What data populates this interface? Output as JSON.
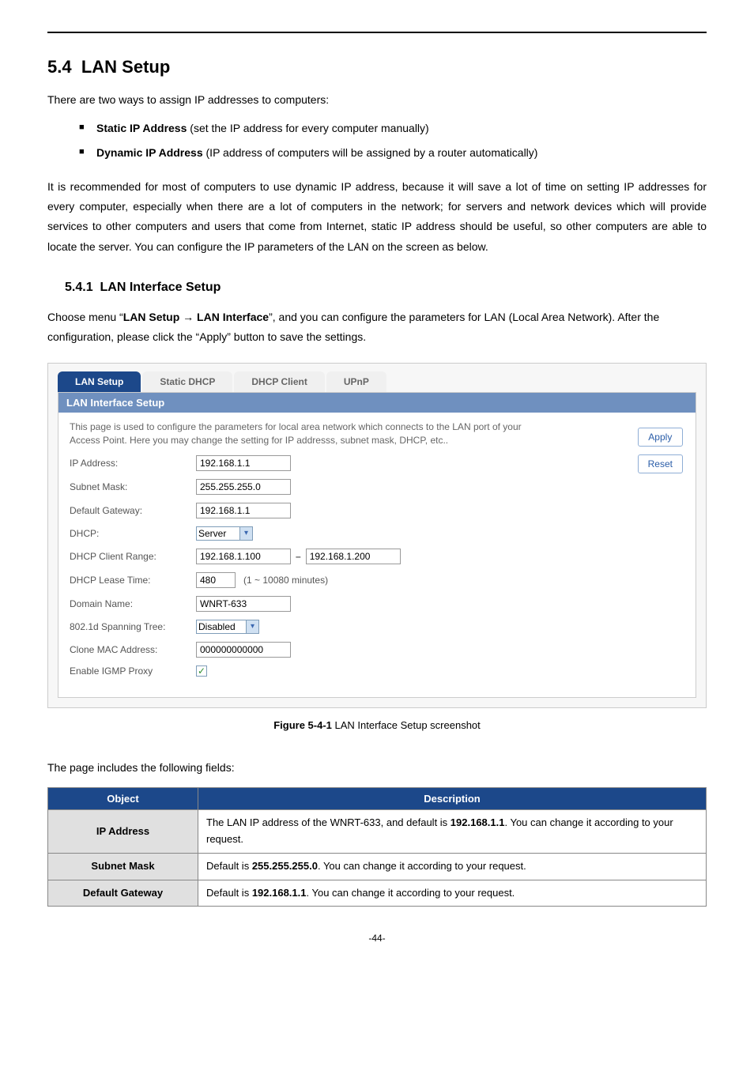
{
  "section": {
    "number": "5.4",
    "title": "LAN Setup",
    "intro": "There are two ways to assign IP addresses to computers:",
    "bullet1_bold": "Static IP Address",
    "bullet1_rest": " (set the IP address for every computer manually)",
    "bullet2_bold": "Dynamic IP Address",
    "bullet2_rest": " (IP address of computers will be assigned by a router automatically)",
    "para2": "It is recommended for most of computers to use dynamic IP address, because it will save a lot of time on setting IP addresses for every computer, especially when there are a lot of computers in the network; for servers and network devices which will provide services to other computers and users that come from Internet, static IP address should be useful, so other computers are able to locate the server. You can configure the IP parameters of the LAN on the screen as below."
  },
  "subsection": {
    "number": "5.4.1",
    "title": "LAN Interface Setup",
    "p1_a": "Choose menu “",
    "p1_b": "LAN Setup ",
    "p1_arrow": "→",
    "p1_c": " LAN Interface",
    "p1_d": "”, and you can configure the parameters for LAN (Local Area Network). After the configuration, please click the “Apply” button to save the settings."
  },
  "ui": {
    "tabs": {
      "t1": "LAN Setup",
      "t2": "Static DHCP",
      "t3": "DHCP Client",
      "t4": "UPnP"
    },
    "panel_title": "LAN Interface Setup",
    "desc": "This page is used to configure the parameters for local area network which connects to the LAN port of your Access Point. Here you may change the setting for IP addresss, subnet mask, DHCP, etc..",
    "apply": "Apply",
    "reset": "Reset",
    "labels": {
      "ip": "IP Address:",
      "mask": "Subnet Mask:",
      "gw": "Default Gateway:",
      "dhcp": "DHCP:",
      "range": "DHCP Client Range:",
      "lease": "DHCP Lease Time:",
      "lease_hint": "(1 ~ 10080 minutes)",
      "domain": "Domain Name:",
      "stp": "802.1d Spanning Tree:",
      "clone": "Clone MAC Address:",
      "igmp": "Enable IGMP Proxy"
    },
    "values": {
      "ip": "192.168.1.1",
      "mask": "255.255.255.0",
      "gw": "192.168.1.1",
      "dhcp": "Server",
      "range_from": "192.168.1.100",
      "range_to": "192.168.1.200",
      "lease": "480",
      "domain": "WNRT-633",
      "stp": "Disabled",
      "clone": "000000000000",
      "igmp_checked": "✓"
    }
  },
  "caption": {
    "label": "Figure 5-4-1",
    "text": " LAN Interface Setup screenshot"
  },
  "table": {
    "lead": "The page includes the following fields:",
    "h1": "Object",
    "h2": "Description",
    "r1_obj": "IP Address",
    "r1_a": "The LAN IP address of the WNRT-633, and default is ",
    "r1_b": "192.168.1.1",
    "r1_c": ". You can change it according to your request.",
    "r2_obj": "Subnet Mask",
    "r2_a": "Default is ",
    "r2_b": "255.255.255.0",
    "r2_c": ". You can change it according to your request.",
    "r3_obj": "Default Gateway",
    "r3_a": "Default is ",
    "r3_b": "192.168.1.1",
    "r3_c": ". You can change it according to your request."
  },
  "pagenum": "-44-"
}
